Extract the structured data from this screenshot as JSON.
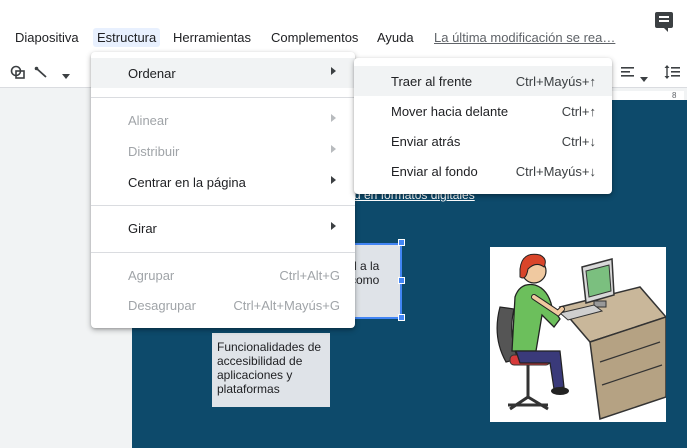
{
  "menubar": {
    "items": [
      "Diapositiva",
      "Estructura",
      "Herramientas",
      "Complementos",
      "Ayuda"
    ],
    "last_modified": "La última modificación se rea…"
  },
  "toolbar": {
    "shape_icon": "shape-icon",
    "line_icon": "line-icon",
    "align_icon": "align-icon",
    "line_spacing_icon": "line-spacing-icon"
  },
  "ruler": {
    "label": "8"
  },
  "menu": {
    "items": [
      {
        "label": "Ordenar",
        "shortcut": "",
        "disabled": false,
        "submenu": true
      },
      {
        "label": "Alinear",
        "shortcut": "",
        "disabled": true,
        "submenu": true
      },
      {
        "label": "Distribuir",
        "shortcut": "",
        "disabled": true,
        "submenu": true
      },
      {
        "label": "Centrar en la página",
        "shortcut": "",
        "disabled": false,
        "submenu": true
      },
      {
        "label": "Girar",
        "shortcut": "",
        "disabled": false,
        "submenu": true
      },
      {
        "label": "Agrupar",
        "shortcut": "Ctrl+Alt+G",
        "disabled": true,
        "submenu": false
      },
      {
        "label": "Desagrupar",
        "shortcut": "Ctrl+Alt+Mayús+G",
        "disabled": true,
        "submenu": false
      }
    ]
  },
  "submenu": {
    "items": [
      {
        "label": "Traer al frente",
        "shortcut": "Ctrl+Mayús+↑"
      },
      {
        "label": "Mover hacia delante",
        "shortcut": "Ctrl+↑"
      },
      {
        "label": "Enviar atrás",
        "shortcut": "Ctrl+↓"
      },
      {
        "label": "Enviar al fondo",
        "shortcut": "Ctrl+Mayús+↓"
      }
    ]
  },
  "slide": {
    "link_text": "d en formatos digitales",
    "selected_text": "d a la\ncomo",
    "textbox2": "Funcionalidades de accesibilidad de aplicaciones y plataformas"
  },
  "colors": {
    "slide_bg": "#0d4a6b",
    "selection": "#4285f4",
    "menu_highlight": "#f1f3f4"
  }
}
